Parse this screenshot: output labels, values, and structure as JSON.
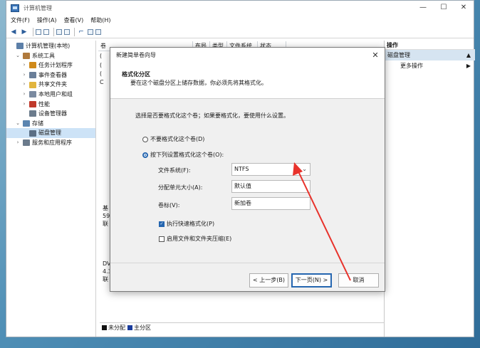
{
  "window": {
    "title": "计算机管理"
  },
  "menu": [
    "文件(F)",
    "操作(A)",
    "查看(V)",
    "帮助(H)"
  ],
  "tree": [
    {
      "label": "计算机管理(本地)",
      "level": 0,
      "chev": "",
      "icon": "computer-icon",
      "color": "#5c7fa8"
    },
    {
      "label": "系统工具",
      "level": 1,
      "chev": "v",
      "icon": "tools-icon",
      "color": "#b07a3c"
    },
    {
      "label": "任务计划程序",
      "level": 2,
      "chev": ">",
      "icon": "clock-icon",
      "color": "#d08a1a"
    },
    {
      "label": "事件查看器",
      "level": 2,
      "chev": ">",
      "icon": "event-viewer-icon",
      "color": "#6a7f99"
    },
    {
      "label": "共享文件夹",
      "level": 2,
      "chev": ">",
      "icon": "folder-icon",
      "color": "#e2b53e"
    },
    {
      "label": "本地用户和组",
      "level": 2,
      "chev": ">",
      "icon": "users-icon",
      "color": "#7a8aa0"
    },
    {
      "label": "性能",
      "level": 2,
      "chev": ">",
      "icon": "performance-icon",
      "color": "#c0392b"
    },
    {
      "label": "设备管理器",
      "level": 2,
      "chev": "",
      "icon": "device-manager-icon",
      "color": "#6b7b8c"
    },
    {
      "label": "存储",
      "level": 1,
      "chev": "v",
      "icon": "storage-icon",
      "color": "#5b85b0"
    },
    {
      "label": "磁盘管理",
      "level": 2,
      "chev": "",
      "icon": "disk-icon",
      "color": "#5b6f85",
      "selected": true
    },
    {
      "label": "服务和应用程序",
      "level": 1,
      "chev": ">",
      "icon": "services-icon",
      "color": "#6b7b8c"
    }
  ],
  "columns": [
    "卷",
    "布局",
    "类型",
    "文件系统",
    "状态"
  ],
  "volume_rows": [
    "(",
    "(",
    "(",
    "C"
  ],
  "disk_rows": [
    {
      "lines": [
        "基",
        "59",
        "联"
      ]
    },
    {
      "lines": [
        "DV",
        "4.3",
        "联"
      ]
    }
  ],
  "legend": [
    {
      "label": "未分配",
      "color": "#111111"
    },
    {
      "label": "主分区",
      "color": "#1a3c9c"
    }
  ],
  "actions": {
    "header": "操作",
    "section": "磁盘管理",
    "item": "更多操作"
  },
  "dialog": {
    "title": "新建简单卷向导",
    "heading": "格式化分区",
    "subheading": "要在这个磁盘分区上储存数据，你必须先将其格式化。",
    "prompt": "选择是否要格式化这个卷；如果要格式化，要使用什么设置。",
    "radio_no": "不要格式化这个卷(D)",
    "radio_yes": "按下列设置格式化这个卷(O):",
    "fs_label": "文件系统(F):",
    "fs_value": "NTFS",
    "alloc_label": "分配单元大小(A):",
    "alloc_value": "默认值",
    "vol_label": "卷标(V):",
    "vol_value": "新加卷",
    "quick_format": "执行快速格式化(P)",
    "compress": "启用文件和文件夹压缩(E)",
    "back": "< 上一步(B)",
    "next": "下一页(N) >",
    "cancel": "取消"
  },
  "accent_color": "#2566b0",
  "annotation_color": "#e8322b"
}
